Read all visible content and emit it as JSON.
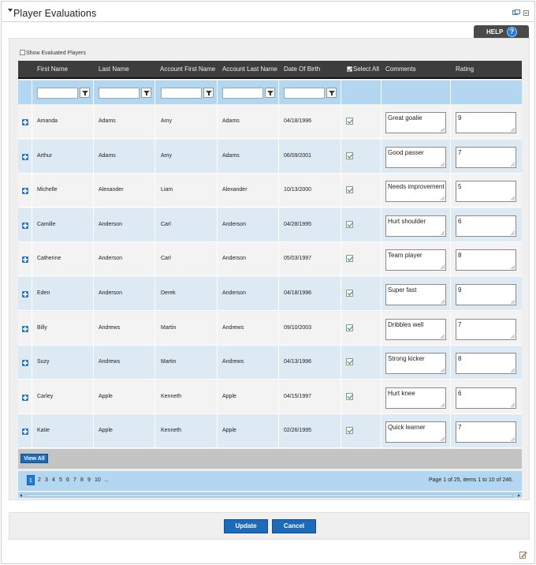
{
  "window": {
    "title": "Player Evaluations",
    "toolbar_icons": [
      "dock-icon",
      "minimize-icon"
    ]
  },
  "help": {
    "label": "HELP",
    "icon": "question-icon",
    "icon_glyph": "?"
  },
  "options": {
    "show_evaluated_label": "Show Evaluated Players",
    "show_evaluated_checked": false
  },
  "grid": {
    "columns": {
      "first_name": "First Name",
      "last_name": "Last Name",
      "account_first_name": "Account First Name",
      "account_last_name": "Account Last Name",
      "dob": "Date Of Birth",
      "select_all": "Select All",
      "comments": "Comments",
      "rating": "Rating"
    },
    "rows": [
      {
        "first": "Amanda",
        "last": "Adams",
        "acct_first": "Amy",
        "acct_last": "Adams",
        "dob": "04/18/1996",
        "selected": true,
        "comment": "Great goalie",
        "rating": "9"
      },
      {
        "first": "Arthur",
        "last": "Adams",
        "acct_first": "Amy",
        "acct_last": "Adams",
        "dob": "06/09/2001",
        "selected": true,
        "comment": "Good passer",
        "rating": "7"
      },
      {
        "first": "Michelle",
        "last": "Alexander",
        "acct_first": "Liam",
        "acct_last": "Alexander",
        "dob": "10/13/2000",
        "selected": true,
        "comment": "Needs improvement",
        "rating": "5"
      },
      {
        "first": "Camille",
        "last": "Anderson",
        "acct_first": "Carl",
        "acct_last": "Anderson",
        "dob": "04/28/1995",
        "selected": true,
        "comment": "Hurt shoulder",
        "rating": "6"
      },
      {
        "first": "Catherine",
        "last": "Anderson",
        "acct_first": "Carl",
        "acct_last": "Anderson",
        "dob": "05/03/1997",
        "selected": true,
        "comment": "Team player",
        "rating": "8"
      },
      {
        "first": "Eden",
        "last": "Anderson",
        "acct_first": "Derek",
        "acct_last": "Anderson",
        "dob": "04/18/1996",
        "selected": true,
        "comment": "Super fast",
        "rating": "9"
      },
      {
        "first": "Billy",
        "last": "Andrews",
        "acct_first": "Martin",
        "acct_last": "Andrews",
        "dob": "09/10/2003",
        "selected": true,
        "comment": "Dribbles well",
        "rating": "7"
      },
      {
        "first": "Suzy",
        "last": "Andrews",
        "acct_first": "Martin",
        "acct_last": "Andrews",
        "dob": "04/13/1996",
        "selected": true,
        "comment": "Strong kicker",
        "rating": "8"
      },
      {
        "first": "Carley",
        "last": "Apple",
        "acct_first": "Kenneth",
        "acct_last": "Apple",
        "dob": "04/15/1997",
        "selected": true,
        "comment": "Hurt knee",
        "rating": "6"
      },
      {
        "first": "Katie",
        "last": "Apple",
        "acct_first": "Kenneth",
        "acct_last": "Apple",
        "dob": "02/26/1995",
        "selected": true,
        "comment": "Quick learner",
        "rating": "7"
      }
    ],
    "view_all_label": "View All"
  },
  "pager": {
    "current": "1",
    "pages": [
      "2",
      "3",
      "4",
      "5",
      "6",
      "7",
      "8",
      "9",
      "10",
      "..."
    ],
    "info": "Page 1 of 25, items 1 to 10 of 246."
  },
  "actions": {
    "update_label": "Update",
    "cancel_label": "Cancel"
  },
  "colors": {
    "header_bg": "#3d3d3d",
    "filter_bg": "#b3d7f0",
    "row_alt": "#ddeaf4",
    "button_blue": "#1d6bb8",
    "check_green": "#1a8a2e"
  }
}
